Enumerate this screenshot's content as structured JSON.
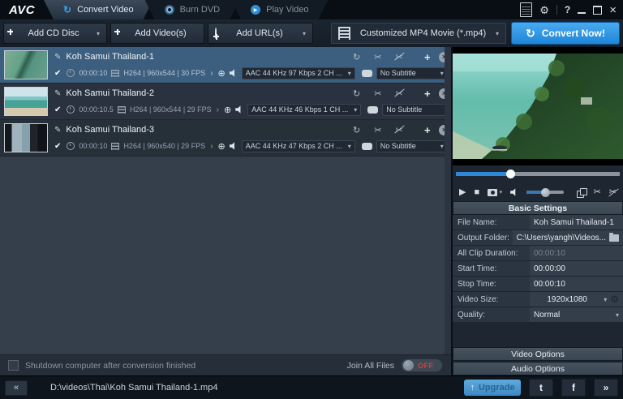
{
  "window": {
    "logo": "AVC",
    "tabs": [
      "Convert Video",
      "Burn DVD",
      "Play Video"
    ]
  },
  "toolbar": {
    "add_cd": "Add CD Disc",
    "add_videos": "Add Video(s)",
    "add_urls": "Add URL(s)",
    "format_value": "Customized MP4 Movie (*.mp4)",
    "convert": "Convert Now!"
  },
  "file_list": {
    "rows": [
      {
        "title": "Koh Samui Thailand-1",
        "duration": "00:00:10",
        "codec": "H264 | 960x544 | 30 FPS",
        "audio": "AAC 44 KHz 97 Kbps 2 CH ...",
        "subtitle": "No Subtitle"
      },
      {
        "title": "Koh Samui Thailand-2",
        "duration": "00:00:10.5",
        "codec": "H264 | 960x544 | 29 FPS",
        "audio": "AAC 44 KHz 46 Kbps 1 CH ...",
        "subtitle": "No Subtitle"
      },
      {
        "title": "Koh Samui Thailand-3",
        "duration": "00:00:10",
        "codec": "H264 | 960x540 | 29 FPS",
        "audio": "AAC 44 KHz 47 Kbps 2 CH ...",
        "subtitle": "No Subtitle"
      }
    ],
    "footer": {
      "shutdown": "Shutdown computer after conversion finished",
      "join": "Join All Files",
      "join_state": "OFF"
    }
  },
  "settings": {
    "header": "Basic Settings",
    "rows": [
      {
        "label": "File Name:",
        "value": "Koh Samui Thailand-1"
      },
      {
        "label": "Output Folder:",
        "value": "C:\\Users\\yangh\\Videos..."
      },
      {
        "label": "All Clip Duration:",
        "value": "00:00:10"
      },
      {
        "label": "Start Time:",
        "value": "00:00:00"
      },
      {
        "label": "Stop Time:",
        "value": "00:00:10"
      },
      {
        "label": "Video Size:",
        "value": "1920x1080"
      },
      {
        "label": "Quality:",
        "value": "Normal"
      }
    ],
    "video_options": "Video Options",
    "audio_options": "Audio Options"
  },
  "statusbar": {
    "path": "D:\\videos\\Thai\\Koh Samui Thailand-1.mp4",
    "upgrade": "Upgrade"
  },
  "colors": {
    "accent_blue": "#2f9be8",
    "selected_row": "#3d5f7f",
    "off_red": "#c4473c"
  },
  "icons": {
    "pencil": "✎",
    "check": "✔",
    "rotate": "↻",
    "scissors": "✂",
    "plus": "+",
    "remove": "×",
    "target": "⊕",
    "chevron": "›",
    "caret": "▾",
    "play": "▶",
    "stop": "■",
    "gear": "⚙",
    "help": "?",
    "close": "×",
    "back": "«",
    "forward": "»",
    "refresh": "↻",
    "upgrade_arrow": "↑",
    "twitter": "t",
    "facebook": "f"
  }
}
